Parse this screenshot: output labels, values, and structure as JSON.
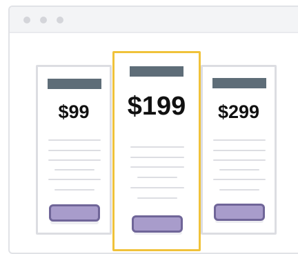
{
  "window": {
    "controls": [
      "close",
      "minimize",
      "maximize"
    ]
  },
  "plans": [
    {
      "price": "$99",
      "featured": false
    },
    {
      "price": "$199",
      "featured": true
    },
    {
      "price": "$299",
      "featured": false
    }
  ],
  "colors": {
    "accent_border": "#f0c23a",
    "header_bar": "#5e6d78",
    "button_fill": "#a89ccb",
    "button_border": "#6f6598",
    "card_border": "#dcdde2"
  }
}
